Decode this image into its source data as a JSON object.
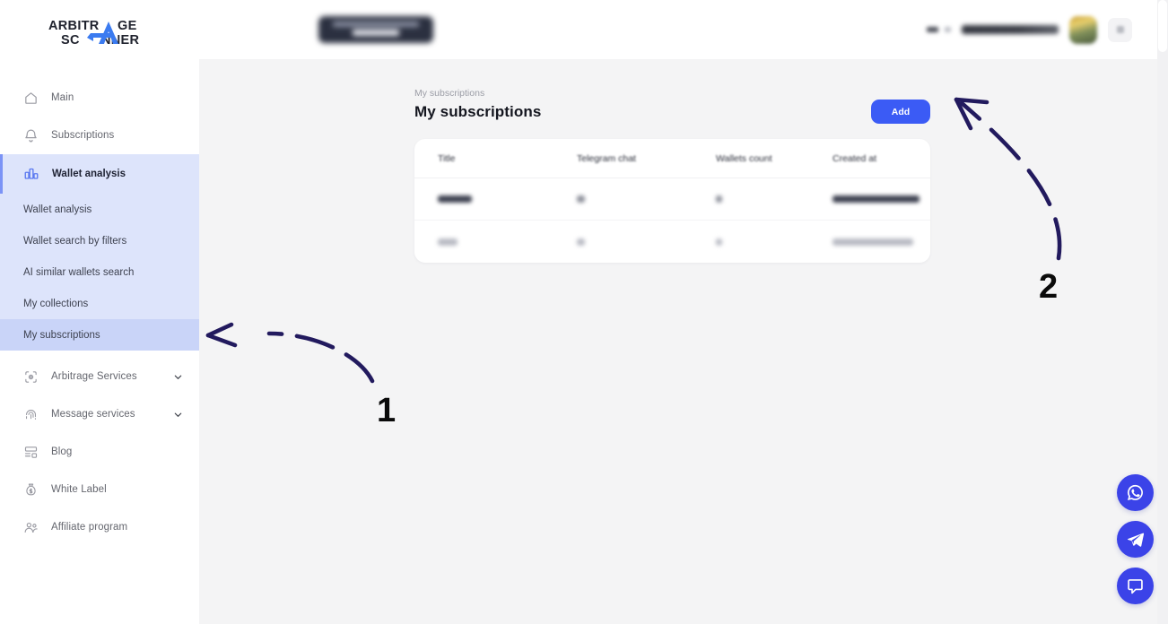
{
  "brand": {
    "name_line1": "ARBITRAGE",
    "name_line2": "SCANNER",
    "accent": "#3b5bf5"
  },
  "sidebar": {
    "items": [
      {
        "label": "Main",
        "icon": "home-icon"
      },
      {
        "label": "Subscriptions",
        "icon": "bell-icon"
      }
    ],
    "group": {
      "label": "Wallet analysis",
      "icon": "bar-chart-icon",
      "chevron": "chevron-up-icon",
      "expanded": true,
      "sub_items": [
        {
          "label": "Wallet analysis",
          "active": false
        },
        {
          "label": "Wallet search by filters",
          "active": false
        },
        {
          "label": "AI similar wallets search",
          "active": false
        },
        {
          "label": "My collections",
          "active": false
        },
        {
          "label": "My subscriptions",
          "active": true
        }
      ]
    },
    "items_after": [
      {
        "label": "Arbitrage Services",
        "icon": "scan-eye-icon",
        "chevron": "chevron-down-icon"
      },
      {
        "label": "Message services",
        "icon": "fingerprint-icon",
        "chevron": "chevron-down-icon"
      },
      {
        "label": "Blog",
        "icon": "blog-icon"
      },
      {
        "label": "White Label",
        "icon": "money-bag-icon"
      },
      {
        "label": "Affiliate program",
        "icon": "users-icon"
      }
    ]
  },
  "main": {
    "breadcrumb": "My subscriptions",
    "title": "My subscriptions",
    "add_label": "Add",
    "table": {
      "headers": [
        "Title",
        "Telegram chat",
        "Wallets count",
        "Created at"
      ],
      "rows": [
        {
          "redacted": true
        },
        {
          "redacted": true
        }
      ]
    }
  },
  "fabs": [
    {
      "name": "whatsapp-fab",
      "icon": "whatsapp-icon"
    },
    {
      "name": "telegram-fab",
      "icon": "telegram-icon"
    },
    {
      "name": "chat-fab",
      "icon": "chat-bubble-icon"
    }
  ],
  "annotations": [
    {
      "label": "1",
      "target": "My subscriptions sidebar item"
    },
    {
      "label": "2",
      "target": "Add button"
    }
  ]
}
